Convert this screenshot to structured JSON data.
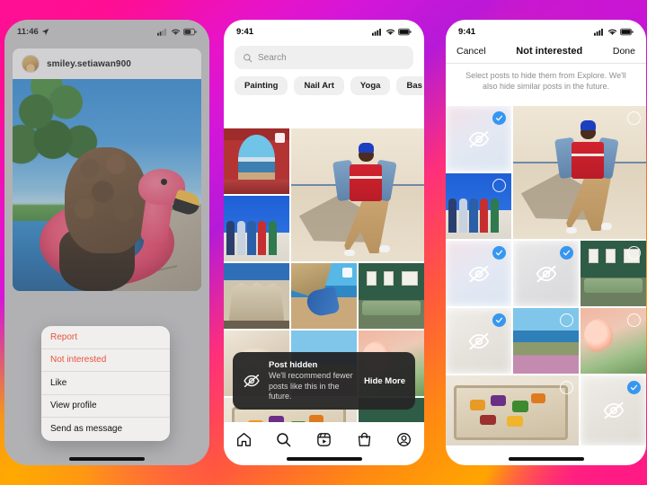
{
  "background": {
    "gradient_colors": [
      "#ff0a9a",
      "#d416d8",
      "#ff2f7a",
      "#ff8a12",
      "#ffa500",
      "#ff1187"
    ],
    "accent_blue": "#3797f0",
    "danger_red": "#e8543f"
  },
  "phone1": {
    "status": {
      "time": "11:46",
      "location_icon": "location-arrow-icon",
      "signal_icon": "cellular-signal-icon",
      "wifi_icon": "wifi-icon",
      "battery_icon": "battery-icon"
    },
    "post": {
      "username": "smiley.setiawan900",
      "avatar": "user-avatar",
      "photo_alt": "dog in pink flamingo pool float"
    },
    "context_menu": [
      {
        "label": "Report",
        "style": "danger"
      },
      {
        "label": "Not interested",
        "style": "danger"
      },
      {
        "label": "Like",
        "style": "normal"
      },
      {
        "label": "View profile",
        "style": "normal"
      },
      {
        "label": "Send as message",
        "style": "normal"
      }
    ]
  },
  "phone2": {
    "status": {
      "time": "9:41",
      "signal_icon": "cellular-signal-icon",
      "wifi_icon": "wifi-icon",
      "battery_icon": "battery-icon"
    },
    "search": {
      "placeholder": "Search",
      "icon": "search-icon"
    },
    "chips": [
      "Painting",
      "Nail Art",
      "Yoga",
      "Bas"
    ],
    "toast": {
      "icon": "eye-slash-icon",
      "title": "Post hidden",
      "subtitle": "We'll recommend fewer posts like this in the future.",
      "action": "Hide More"
    },
    "tabbar": [
      {
        "name": "home-tab",
        "icon": "home-icon"
      },
      {
        "name": "search-tab",
        "icon": "search-icon"
      },
      {
        "name": "reels-tab",
        "icon": "reels-icon"
      },
      {
        "name": "shop-tab",
        "icon": "shop-bag-icon"
      },
      {
        "name": "profile-tab",
        "icon": "profile-circle-icon"
      }
    ],
    "grid": [
      {
        "id": "arch",
        "art": "art-arch",
        "saved": true
      },
      {
        "id": "dancer",
        "art": "art-dancer",
        "saved": false
      },
      {
        "id": "friends",
        "art": "art-friends",
        "saved": false
      },
      {
        "id": "building",
        "art": "art-building",
        "saved": false
      },
      {
        "id": "beach",
        "art": "art-beach",
        "saved": true
      },
      {
        "id": "gallery",
        "art": "art-gallery",
        "saved": false
      },
      {
        "id": "sand",
        "art": "art-sand",
        "saved": false
      },
      {
        "id": "coast",
        "art": "art-coast",
        "saved": false
      },
      {
        "id": "flowers",
        "art": "art-flowers",
        "saved": false
      },
      {
        "id": "veg",
        "art": "art-veg",
        "saved": false
      },
      {
        "id": "table",
        "art": "art-table",
        "saved": false
      }
    ]
  },
  "phone3": {
    "status": {
      "time": "9:41",
      "signal_icon": "cellular-signal-icon",
      "wifi_icon": "wifi-icon",
      "battery_icon": "battery-icon"
    },
    "nav": {
      "cancel": "Cancel",
      "title": "Not interested",
      "done": "Done"
    },
    "subtitle": "Select posts to hide them from Explore. We'll also hide similar posts in the future.",
    "grid": [
      {
        "id": "arch",
        "art": "art-blurA",
        "selected": true
      },
      {
        "id": "dancer",
        "art": "art-dancer",
        "selected": false
      },
      {
        "id": "friends",
        "art": "art-friends",
        "selected": false
      },
      {
        "id": "building",
        "art": "art-blurA",
        "selected": true
      },
      {
        "id": "beach",
        "art": "art-blurB",
        "selected": true
      },
      {
        "id": "gallery",
        "art": "art-gallery",
        "selected": false
      },
      {
        "id": "sand",
        "art": "art-blurC",
        "selected": true
      },
      {
        "id": "coast",
        "art": "art-coast",
        "selected": false
      },
      {
        "id": "flowers",
        "art": "art-flowers",
        "selected": false
      },
      {
        "id": "veg",
        "art": "art-veg",
        "selected": false
      },
      {
        "id": "table",
        "art": "art-blurC",
        "selected": true
      }
    ]
  }
}
